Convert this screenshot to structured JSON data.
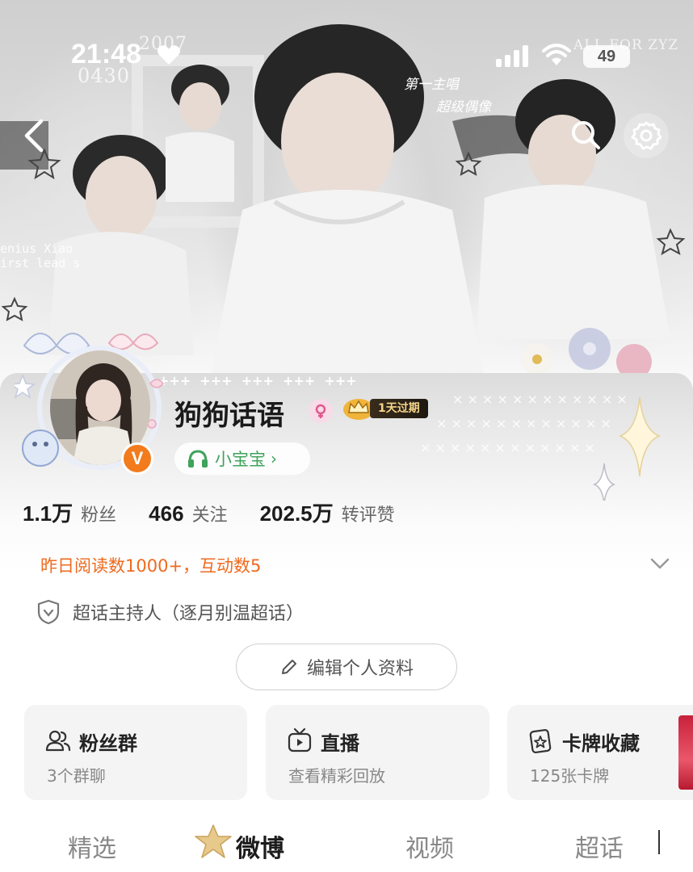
{
  "status_bar": {
    "time": "21:48",
    "battery": "49"
  },
  "cover": {
    "watermark_year": "2007",
    "watermark_date": "0430",
    "watermark_tag": "ALL FOR ZYZ",
    "side_text_line1": "enius Xiao",
    "side_text_line2": "irst lead s",
    "slogan_line1": "第一主唱",
    "slogan_line2": "超级偶像"
  },
  "profile": {
    "username": "狗狗话语",
    "verified_mark": "V",
    "vip_label": "1天过期",
    "fan_pill_label": "小宝宝",
    "fan_pill_chevron": "›"
  },
  "stats": [
    {
      "value": "1.1万",
      "label": "粉丝"
    },
    {
      "value": "466",
      "label": "关注"
    },
    {
      "value": "202.5万",
      "label": "转评赞"
    }
  ],
  "insight": "昨日阅读数1000+，互动数5",
  "host": "超话主持人（逐月别温超话）",
  "edit_button": "编辑个人资料",
  "quick_cards": [
    {
      "title": "粉丝群",
      "subtitle": "3个群聊",
      "icon": "people-icon"
    },
    {
      "title": "直播",
      "subtitle": "查看精彩回放",
      "icon": "tv-icon"
    },
    {
      "title": "卡牌收藏",
      "subtitle": "125张卡牌",
      "icon": "card-star-icon"
    }
  ],
  "tabs": [
    "精选",
    "微博",
    "视频",
    "超话"
  ],
  "colors": {
    "accent_orange": "#ef6a1f",
    "green": "#3fa35c",
    "vip_gold": "#f5d58a"
  }
}
